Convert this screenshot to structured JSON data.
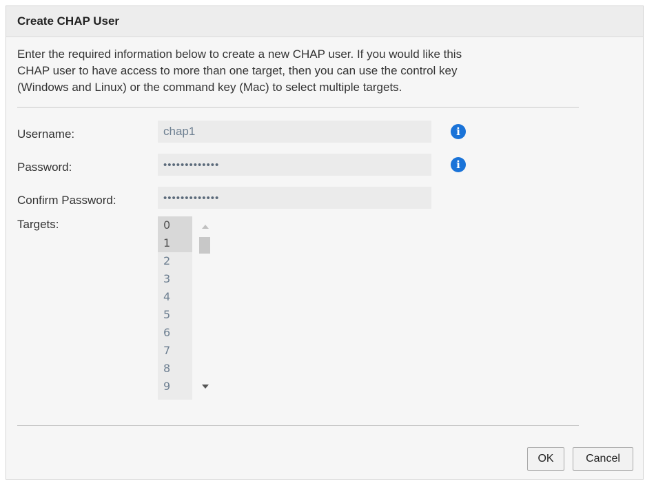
{
  "dialog": {
    "title": "Create CHAP User",
    "intro_lines": [
      "Enter the required information below to create a new CHAP user. If you would like this",
      "CHAP user to have access to more than one target, then you can use the control key",
      "(Windows and Linux) or the command key (Mac) to select multiple targets."
    ]
  },
  "form": {
    "username_label": "Username:",
    "username_value": "chap1",
    "password_label": "Password:",
    "password_value": "•••••••••••••",
    "confirm_label": "Confirm Password:",
    "confirm_value": "•••••••••••••",
    "targets_label": "Targets:",
    "targets": [
      "0",
      "1",
      "2",
      "3",
      "4",
      "5",
      "6",
      "7",
      "8",
      "9"
    ],
    "selected_targets": [
      "0",
      "1"
    ]
  },
  "buttons": {
    "ok": "OK",
    "cancel": "Cancel"
  },
  "icons": {
    "info": "info-icon",
    "glyph": "i"
  },
  "colors": {
    "info_icon": "#1a73d8",
    "field_bg": "#ebebeb"
  }
}
